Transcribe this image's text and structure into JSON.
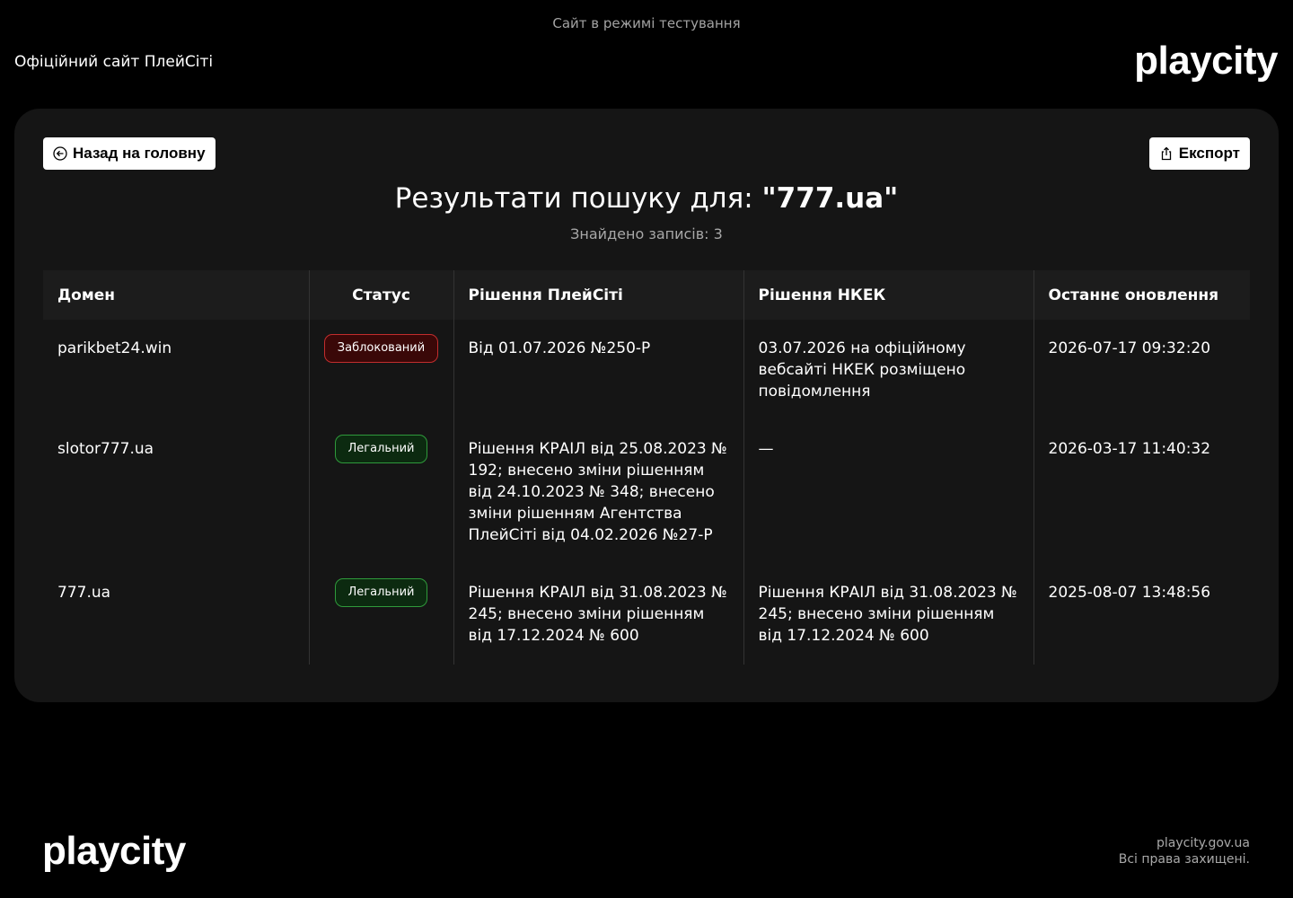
{
  "banner": "Сайт в режимі тестування",
  "header": {
    "site_title": "Офіційний сайт ПлейСіті",
    "logo": "playcity"
  },
  "toolbar": {
    "back_label": "Назад на головну",
    "export_label": "Експорт"
  },
  "results": {
    "title_prefix": "Результати пошуку для: ",
    "query": "\"777.ua\"",
    "count": "Знайдено записів: 3"
  },
  "table": {
    "headers": [
      "Домен",
      "Статус",
      "Рішення ПлейСіті",
      "Рішення НКЕК",
      "Останнє оновлення"
    ],
    "rows": [
      {
        "domain": "parikbet24.win",
        "status": "Заблокований",
        "status_type": "blocked",
        "playcity": "Від 01.07.2026 №250-Р",
        "nkek": "03.07.2026 на офіційному вебсайті НКЕК розміщено повідомлення",
        "updated": "2026-07-17 09:32:20"
      },
      {
        "domain": "slotor777.ua",
        "status": "Легальний",
        "status_type": "legal",
        "playcity": "Рішення КРАІЛ від 25.08.2023 № 192; внесено зміни рішенням від 24.10.2023 № 348; внесено зміни рішенням Агентства ПлейСіті від 04.02.2026 №27-Р",
        "nkek": "—",
        "updated": "2026-03-17 11:40:32"
      },
      {
        "domain": "777.ua",
        "status": "Легальний",
        "status_type": "legal",
        "playcity": "Рішення КРАІЛ від 31.08.2023 № 245; внесено зміни рішенням від 17.12.2024 № 600",
        "nkek": "Рішення КРАІЛ від 31.08.2023 № 245; внесено зміни рішенням від 17.12.2024 № 600",
        "updated": "2025-08-07 13:48:56"
      }
    ]
  },
  "footer": {
    "logo": "playcity",
    "domain": "playcity.gov.ua",
    "rights": "Всі права захищені."
  },
  "colors": {
    "background": "#000000",
    "card": "#151515",
    "blocked": "#c22d2d",
    "legal": "#2f9a3b"
  }
}
